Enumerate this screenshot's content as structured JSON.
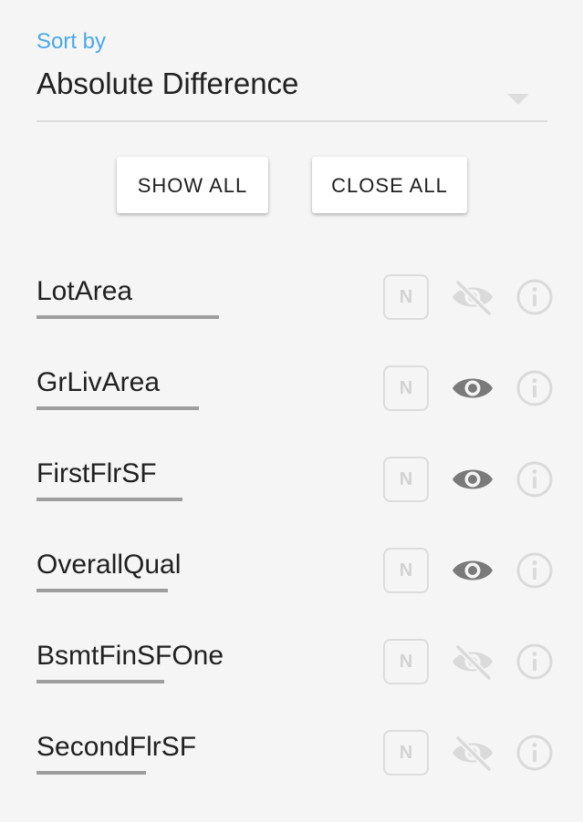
{
  "sort": {
    "label": "Sort by",
    "value": "Absolute Difference"
  },
  "buttons": {
    "show_all": "SHOW ALL",
    "close_all": "CLOSE ALL"
  },
  "features": [
    {
      "name": "LotArea",
      "badge": "N",
      "visible": false,
      "bar_fraction": 1.0
    },
    {
      "name": "GrLivArea",
      "badge": "N",
      "visible": true,
      "bar_fraction": 0.89
    },
    {
      "name": "FirstFlrSF",
      "badge": "N",
      "visible": true,
      "bar_fraction": 0.8
    },
    {
      "name": "OverallQual",
      "badge": "N",
      "visible": true,
      "bar_fraction": 0.72
    },
    {
      "name": "BsmtFinSFOne",
      "badge": "N",
      "visible": false,
      "bar_fraction": 0.7
    },
    {
      "name": "SecondFlrSF",
      "badge": "N",
      "visible": false,
      "bar_fraction": 0.6
    }
  ],
  "colors": {
    "accent": "#4aa8ec",
    "bar": "#9e9e9e",
    "icon_active": "#7a7a7a",
    "icon_inactive": "#dadada"
  },
  "icons": {
    "visible": "eye-icon",
    "hidden": "eye-off-icon",
    "info": "info-icon"
  }
}
